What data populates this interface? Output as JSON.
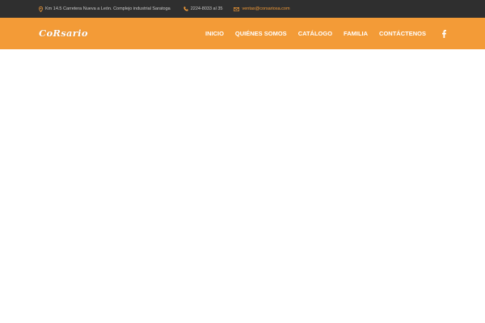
{
  "topbar": {
    "address": "Km 14.5 Carretera Nueva a León. Complejo industrial Saratoga",
    "phone": "2224-8033 al 35",
    "email": "ventas@corsariosa.com"
  },
  "brand": {
    "logo_text": "CoRsario"
  },
  "nav": {
    "items": [
      {
        "label": "INICIO"
      },
      {
        "label": "QUIÉNES SOMOS"
      },
      {
        "label": "CATÁLOGO"
      },
      {
        "label": "FAMILIA"
      },
      {
        "label": "CONTÁCTENOS"
      }
    ],
    "social_icon": "facebook-icon"
  },
  "colors": {
    "topbar_bg": "#2f2f2f",
    "accent": "#f39b37",
    "nav_text": "#ffffff",
    "page_bg": "#ffffff"
  }
}
